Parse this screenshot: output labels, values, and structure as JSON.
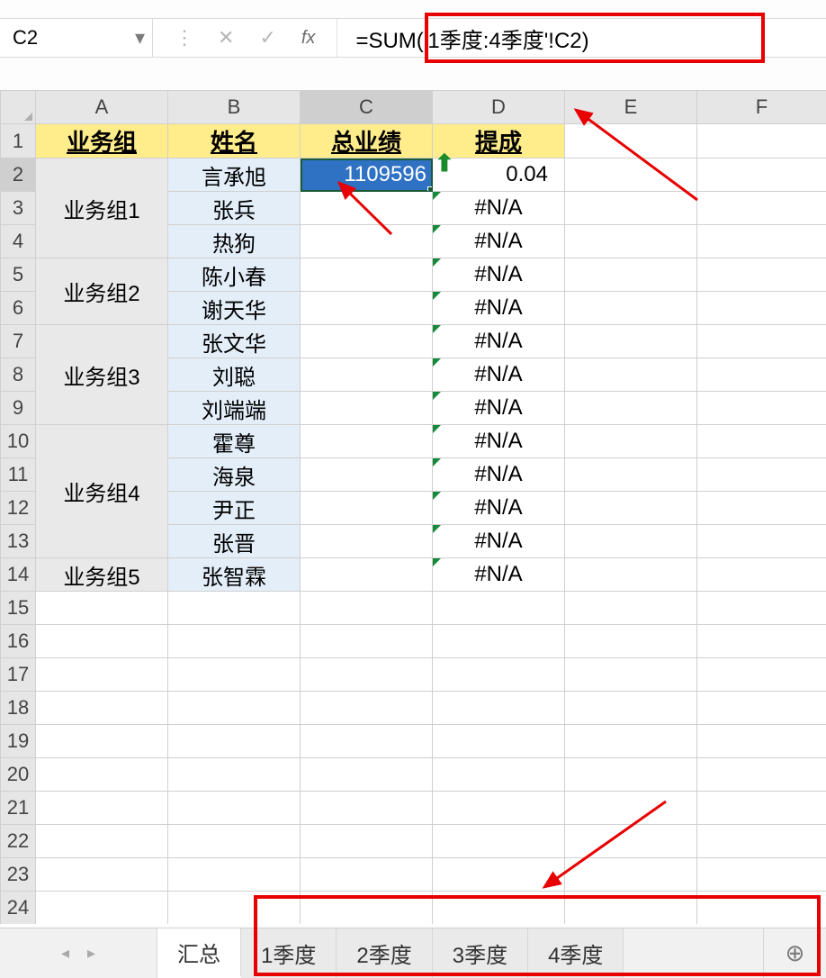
{
  "nameBox": "C2",
  "formula": "=SUM('1季度:4季度'!C2)",
  "fxLabel": "fx",
  "columns": [
    "A",
    "B",
    "C",
    "D",
    "E",
    "F"
  ],
  "activeColumn": "C",
  "rowCount": 24,
  "activeRow": 2,
  "headers": {
    "A": "业务组",
    "B": "姓名",
    "C": "总业绩",
    "D": "提成"
  },
  "groups": [
    {
      "name": "业务组1",
      "span": 3,
      "rows": [
        {
          "name": "言承旭",
          "c": "1109596",
          "d": "0.04",
          "selected": true
        },
        {
          "name": "张兵",
          "c": "",
          "d": "#N/A"
        },
        {
          "name": "热狗",
          "c": "",
          "d": "#N/A"
        }
      ]
    },
    {
      "name": "业务组2",
      "span": 2,
      "rows": [
        {
          "name": "陈小春",
          "c": "",
          "d": "#N/A"
        },
        {
          "name": "谢天华",
          "c": "",
          "d": "#N/A"
        }
      ]
    },
    {
      "name": "业务组3",
      "span": 3,
      "rows": [
        {
          "name": "张文华",
          "c": "",
          "d": "#N/A"
        },
        {
          "name": "刘聪",
          "c": "",
          "d": "#N/A"
        },
        {
          "name": "刘端端",
          "c": "",
          "d": "#N/A"
        }
      ]
    },
    {
      "name": "业务组4",
      "span": 4,
      "rows": [
        {
          "name": "霍尊",
          "c": "",
          "d": "#N/A"
        },
        {
          "name": "海泉",
          "c": "",
          "d": "#N/A"
        },
        {
          "name": "尹正",
          "c": "",
          "d": "#N/A"
        },
        {
          "name": "张晋",
          "c": "",
          "d": "#N/A"
        }
      ]
    },
    {
      "name": "业务组5",
      "span": 1,
      "rows": [
        {
          "name": "张智霖",
          "c": "",
          "d": "#N/A"
        }
      ]
    }
  ],
  "tabs": {
    "active": "汇总",
    "list": [
      "汇总",
      "1季度",
      "2季度",
      "3季度",
      "4季度"
    ]
  },
  "glyphs": {
    "dropdown": "▾",
    "vdots": "⋮",
    "cancel": "✕",
    "confirm": "✓",
    "navPrev": "◂",
    "navNext": "▸",
    "addTab": "⊕",
    "upArrow": "⬆"
  }
}
